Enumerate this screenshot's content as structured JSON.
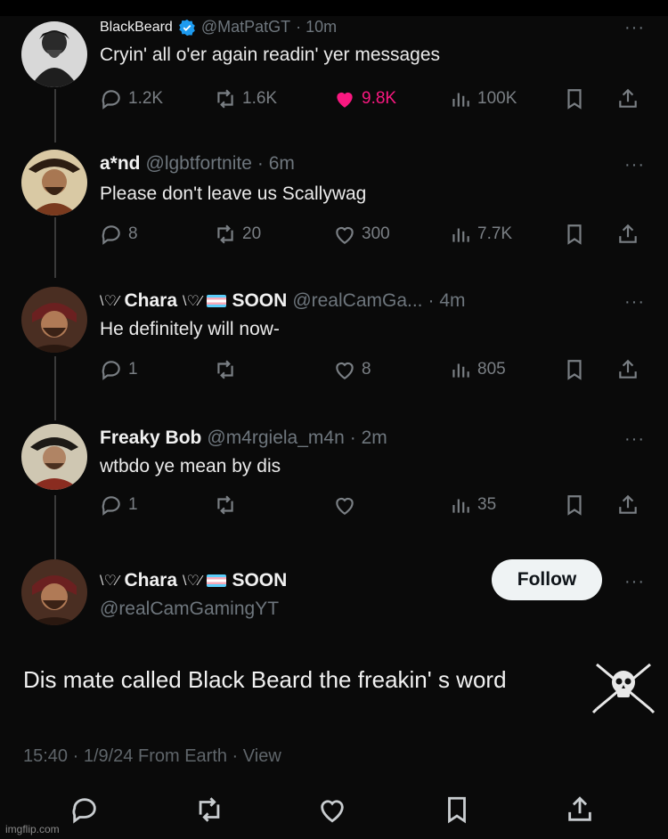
{
  "posts": [
    {
      "name": "BlackBeard",
      "handle": "@MatPatGT",
      "time": "· 10m",
      "text": "Cryin' all o'er again readin' yer messages",
      "replies": "1.2K",
      "retweets": "1.6K",
      "likes": "9.8K",
      "views": "100K",
      "liked": true
    },
    {
      "name": "a*nd",
      "handle": "@lgbtfortnite",
      "time": "· 6m",
      "text": "Please don't leave us Scallywag",
      "replies": "8",
      "retweets": "20",
      "likes": "300",
      "views": "7.7K"
    },
    {
      "name": "Chara",
      "name_suffix": "SOON",
      "handle": "@realCamGa...",
      "time": "· 4m",
      "text": "He definitely will now-",
      "replies": "1",
      "retweets": "",
      "likes": "8",
      "views": "805"
    },
    {
      "name": "Freaky Bob",
      "handle": "@m4rgiela_m4n",
      "time": "· 2m",
      "text": "wtbdo ye mean by dis",
      "replies": "1",
      "retweets": "",
      "likes": "",
      "views": "35"
    }
  ],
  "focused": {
    "name": "Chara",
    "name_suffix": "SOON",
    "handle": "@realCamGamingYT",
    "follow_label": "Follow",
    "text": "Dis mate called Black Beard the freakin' s word",
    "meta": "15:40 · 1/9/24 From Earth · View"
  },
  "more_label": "···",
  "watermark": "imgflip.com",
  "colors": {
    "like": "#f91880",
    "verified": "#1d9bf0",
    "background": "#0a0a0a"
  }
}
